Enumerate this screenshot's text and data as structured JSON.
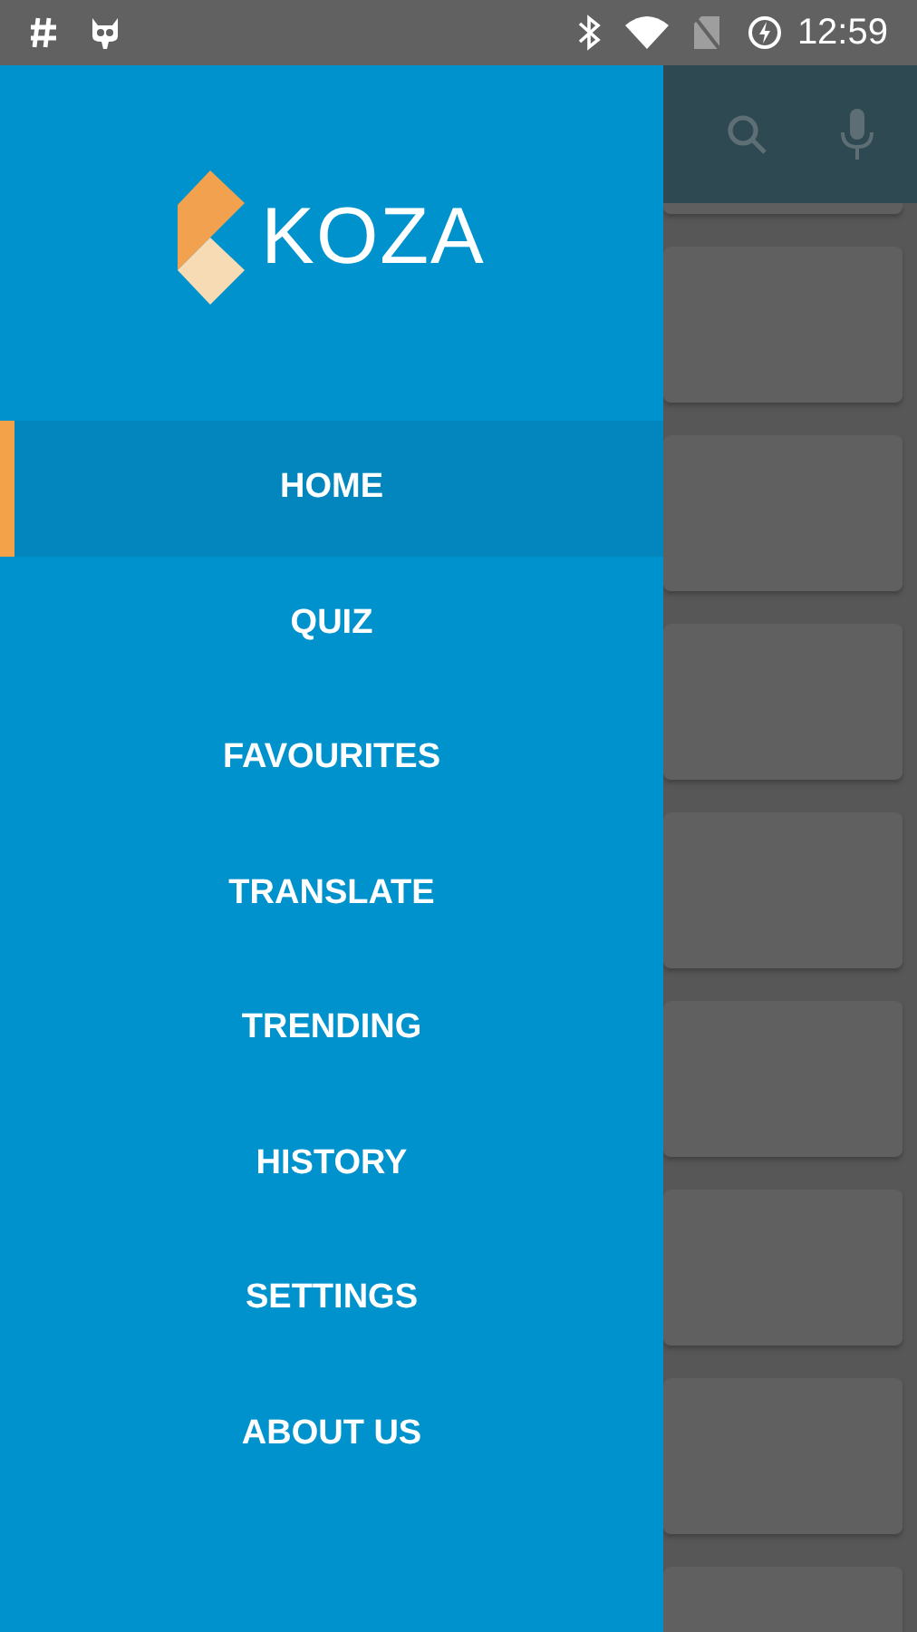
{
  "status_bar": {
    "time": "12:59"
  },
  "drawer": {
    "logo": "KOZA",
    "items": [
      {
        "label": "HOME",
        "selected": true
      },
      {
        "label": "QUIZ",
        "selected": false
      },
      {
        "label": "FAVOURITES",
        "selected": false
      },
      {
        "label": "TRANSLATE",
        "selected": false
      },
      {
        "label": "TRENDING",
        "selected": false
      },
      {
        "label": "HISTORY",
        "selected": false
      },
      {
        "label": "SETTINGS",
        "selected": false
      },
      {
        "label": "ABOUT US",
        "selected": false
      }
    ]
  }
}
